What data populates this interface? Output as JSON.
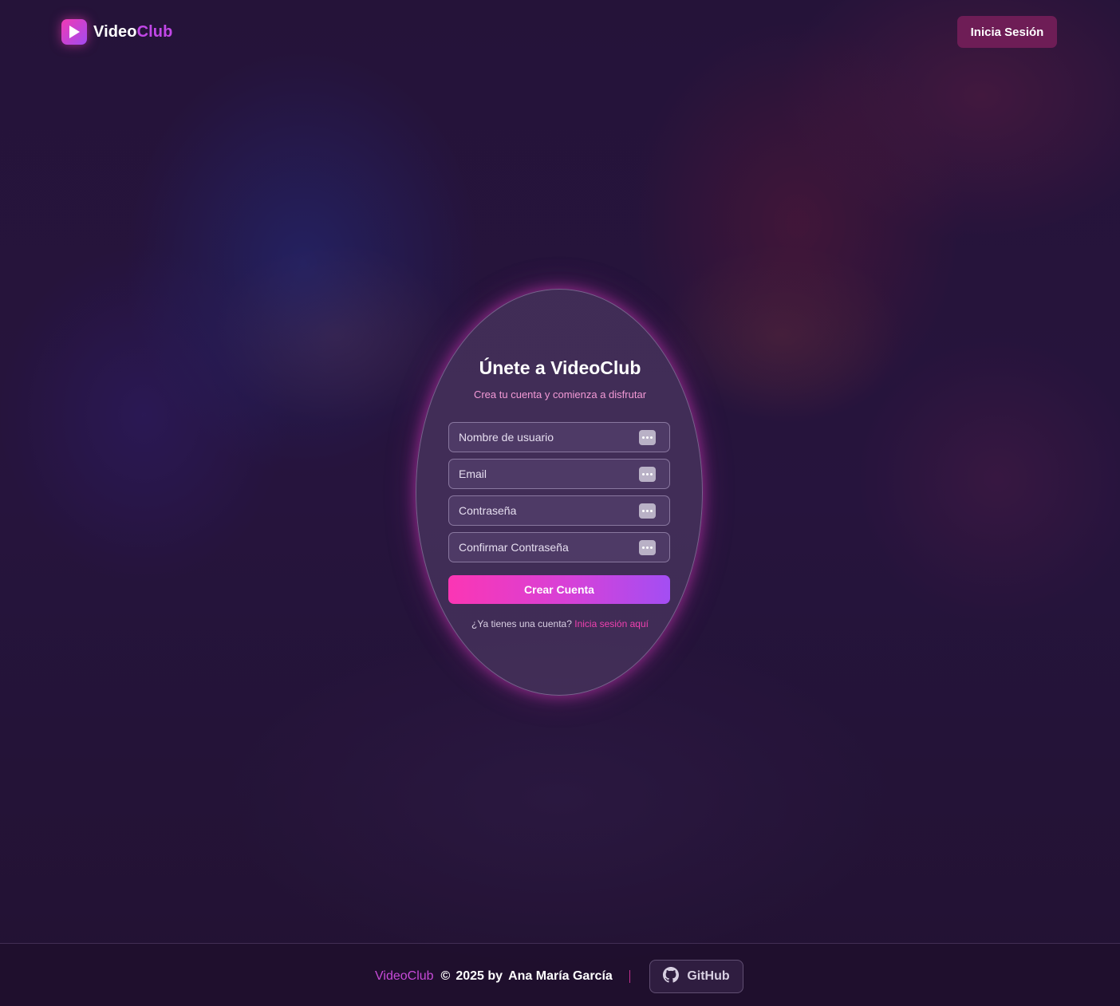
{
  "header": {
    "logo_part1": "Video",
    "logo_part2": "Club",
    "login_label": "Inicia Sesión"
  },
  "form": {
    "title": "Únete a VideoClub",
    "subtitle": "Crea tu cuenta y comienza a disfrutar",
    "fields": [
      {
        "placeholder": "Nombre de usuario",
        "value": ""
      },
      {
        "placeholder": "Email",
        "value": ""
      },
      {
        "placeholder": "Contraseña",
        "value": ""
      },
      {
        "placeholder": "Confirmar Contraseña",
        "value": ""
      }
    ],
    "submit_label": "Crear Cuenta",
    "have_account_text": "¿Ya tienes una cuenta?",
    "login_link": "Inicia sesión aquí"
  },
  "footer": {
    "brand": "VideoClub",
    "copyright_symbol": "©",
    "year_by": "2025 by",
    "author": "Ana María García",
    "github_label": "GitHub"
  },
  "colors": {
    "accent_pink": "#f03ab4",
    "accent_purple": "#a24bf0",
    "login_button_bg": "#6e1d56"
  },
  "icons": {
    "logo": "play-icon",
    "field_action": "dots-icon",
    "github": "github-icon"
  }
}
